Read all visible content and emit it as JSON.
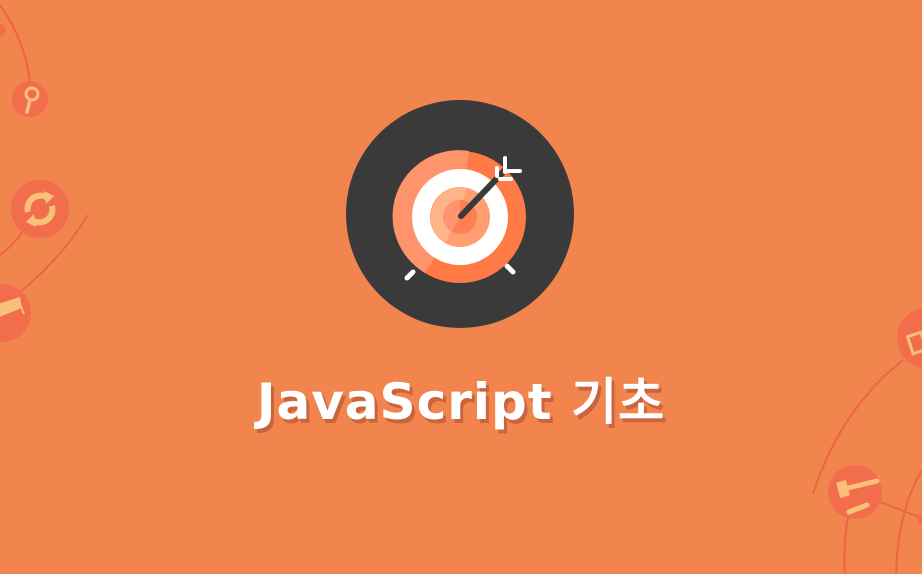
{
  "title": "JavaScript 기초",
  "colors": {
    "background": "#f2844e",
    "badge": "#3a3a3a",
    "target_outer": "#ff7a45",
    "deco_circle": "#f26d4b",
    "deco_glyph": "#f9c07a"
  },
  "icons": [
    "magnifier-icon",
    "refresh-icon",
    "graduation-cap-icon",
    "monitor-icon",
    "gavel-icon",
    "target-icon",
    "arrow-icon"
  ]
}
